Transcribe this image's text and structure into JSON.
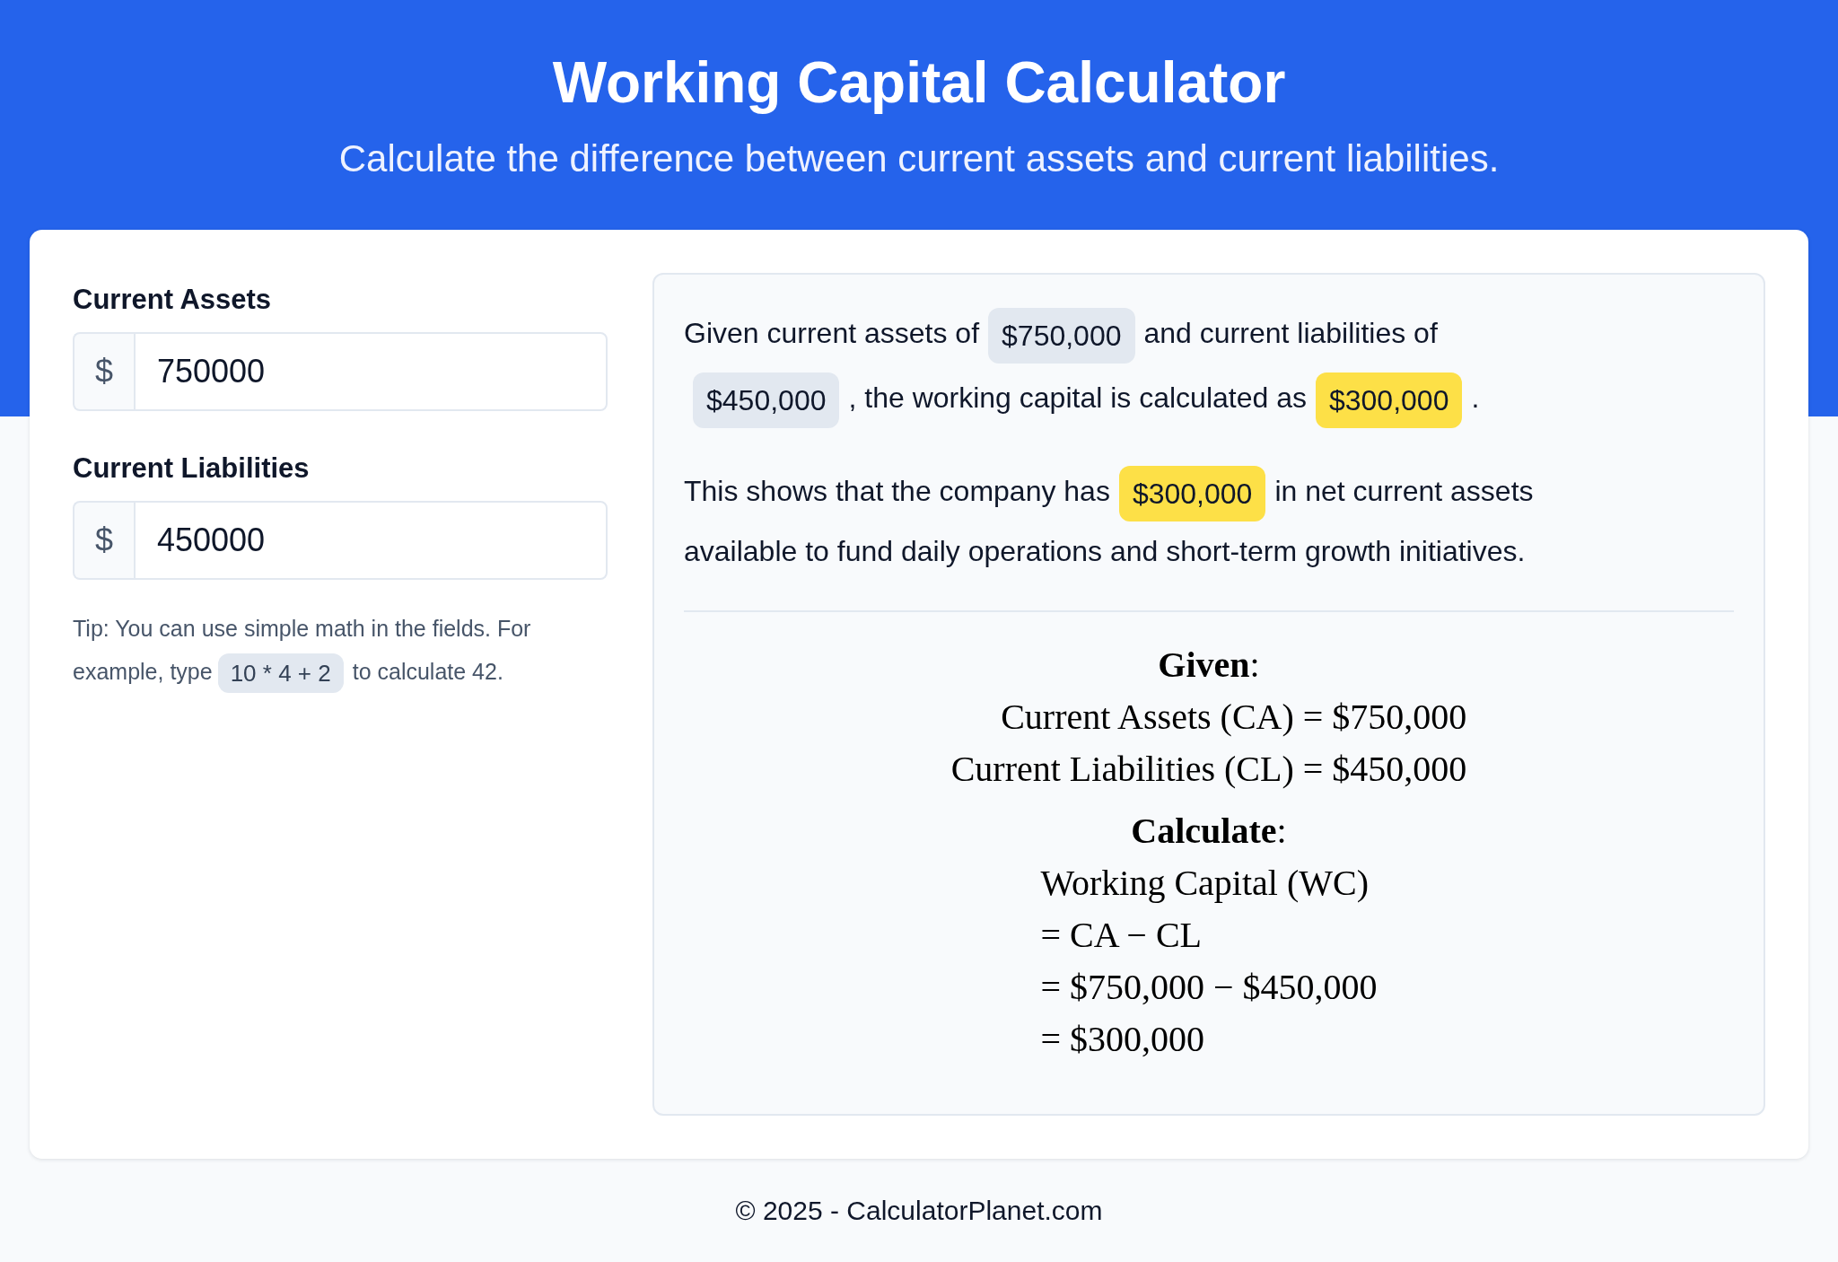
{
  "header": {
    "title": "Working Capital Calculator",
    "subtitle": "Calculate the difference between current assets and current liabilities."
  },
  "inputs": [
    {
      "label": "Current Assets",
      "prefix": "$",
      "value": "750000"
    },
    {
      "label": "Current Liabilities",
      "prefix": "$",
      "value": "450000"
    }
  ],
  "tip": {
    "lines": [
      [
        {
          "kind": "text",
          "text": "Tip: You can use simple math in the fields. For"
        }
      ],
      [
        {
          "kind": "text",
          "text": "example, type"
        },
        {
          "kind": "code",
          "text": "10 * 4 + 2"
        },
        {
          "kind": "text",
          "text": "to calculate 42."
        }
      ]
    ]
  },
  "summary": {
    "paragraphs": [
      {
        "lines": [
          [
            {
              "kind": "text",
              "text": "Given current assets of"
            },
            {
              "kind": "value",
              "text": "$750,000"
            },
            {
              "kind": "text",
              "text": "and current liabilities of"
            }
          ],
          [
            {
              "kind": "value",
              "text": "$450,000"
            },
            {
              "kind": "text",
              "text": ", the working capital is calculated as"
            },
            {
              "kind": "result",
              "text": "$300,000"
            },
            {
              "kind": "text",
              "text": "."
            }
          ]
        ]
      },
      {
        "lines": [
          [
            {
              "kind": "text",
              "text": "This shows that the company has"
            },
            {
              "kind": "result",
              "text": "$300,000"
            },
            {
              "kind": "text",
              "text": "in net current assets"
            }
          ],
          [
            {
              "kind": "text",
              "text": "available to fund daily operations and short-term growth initiatives."
            }
          ]
        ]
      }
    ]
  },
  "formula": {
    "blocks": [
      {
        "kind": "definitions",
        "heading": "**Given**:",
        "lines": [
          "Current Assets (CA) = $750,000",
          "Current Liabilities (CL) = $450,000"
        ]
      },
      {
        "kind": "derivation",
        "heading": "**Calculate**:",
        "lines": [
          "Working Capital (WC)",
          "= CA − CL",
          "= $750,000 − $450,000",
          "= $300,000"
        ]
      }
    ]
  },
  "footer": {
    "text": "© 2025 - CalculatorPlanet.com"
  }
}
